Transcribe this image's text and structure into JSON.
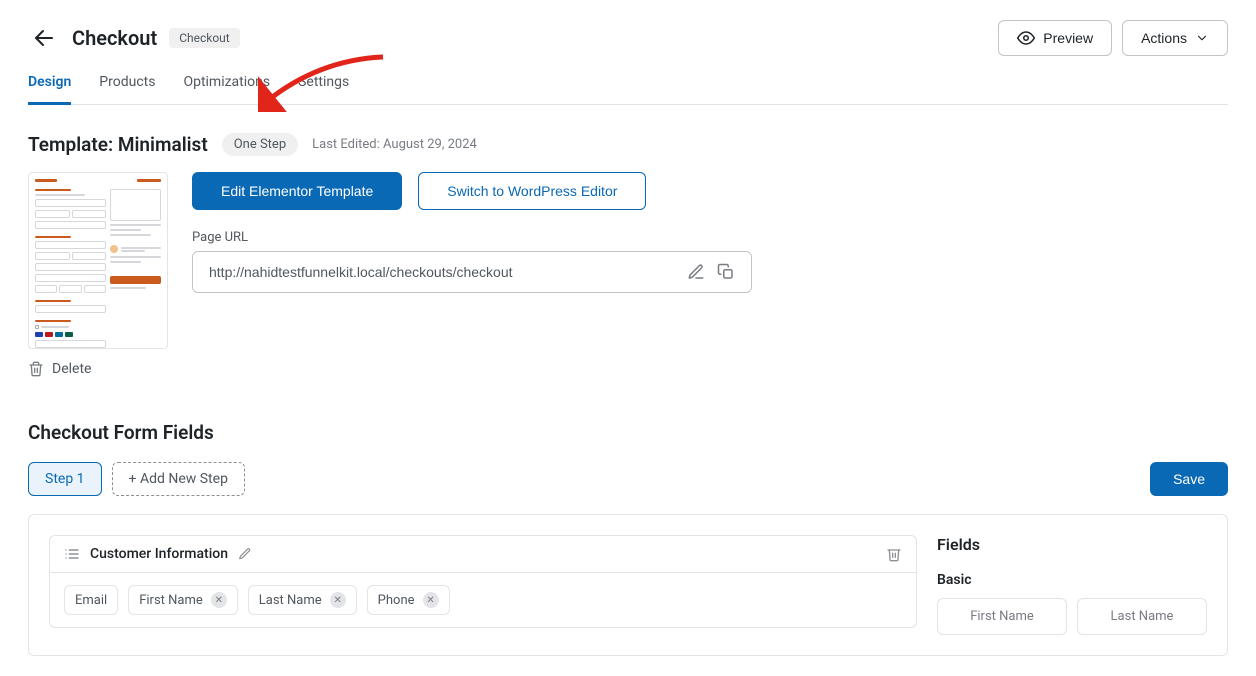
{
  "header": {
    "title": "Checkout",
    "chip": "Checkout",
    "preview_label": "Preview",
    "actions_label": "Actions"
  },
  "tabs": [
    {
      "id": "design",
      "label": "Design",
      "active": true
    },
    {
      "id": "products",
      "label": "Products",
      "active": false
    },
    {
      "id": "optimizations",
      "label": "Optimizations",
      "active": false
    },
    {
      "id": "settings",
      "label": "Settings",
      "active": false
    }
  ],
  "template": {
    "title": "Template: Minimalist",
    "steps_chip": "One Step",
    "last_edited": "Last Edited: August 29, 2024",
    "edit_btn": "Edit Elementor Template",
    "switch_btn": "Switch to WordPress Editor",
    "page_url_label": "Page URL",
    "page_url": "http://nahidtestfunnelkit.local/checkouts/checkout",
    "delete_label": "Delete"
  },
  "form": {
    "section_title": "Checkout Form Fields",
    "step1_label": "Step 1",
    "add_step_label": "+ Add New Step",
    "save_label": "Save",
    "customer_section": {
      "title": "Customer Information",
      "fields": [
        "Email",
        "First Name",
        "Last Name",
        "Phone"
      ]
    }
  },
  "fields_panel": {
    "heading": "Fields",
    "group_label": "Basic",
    "available": [
      "First Name",
      "Last Name"
    ]
  },
  "annotation": {
    "arrow_target": "optimizations-tab"
  }
}
